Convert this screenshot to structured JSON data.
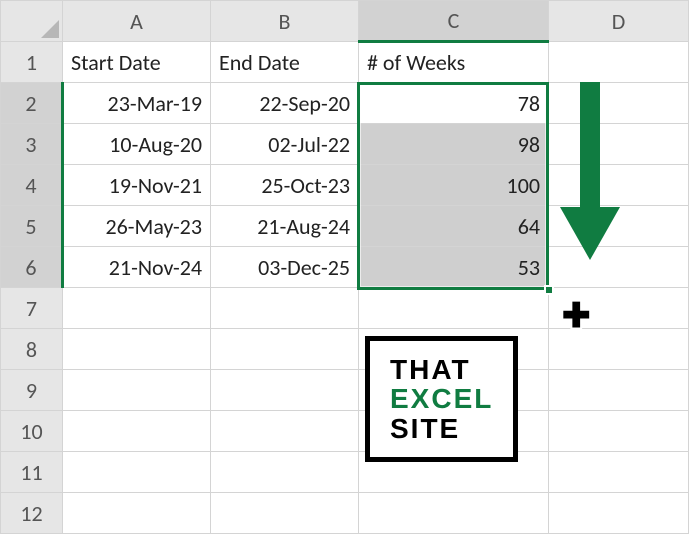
{
  "columns": {
    "A": "A",
    "B": "B",
    "C": "C",
    "D": "D"
  },
  "selectedColumn": "C",
  "rows": [
    "1",
    "2",
    "3",
    "4",
    "5",
    "6",
    "7",
    "8",
    "9",
    "10",
    "11",
    "12"
  ],
  "selectedRows": [
    "2",
    "3",
    "4",
    "5",
    "6"
  ],
  "headers": {
    "A": "Start Date",
    "B": "End Date",
    "C": "# of Weeks"
  },
  "data": [
    {
      "A": "23-Mar-19",
      "B": "22-Sep-20",
      "C": "78"
    },
    {
      "A": "10-Aug-20",
      "B": "02-Jul-22",
      "C": "98"
    },
    {
      "A": "19-Nov-21",
      "B": "25-Oct-23",
      "C": "100"
    },
    {
      "A": "26-May-23",
      "B": "21-Aug-24",
      "C": "64"
    },
    {
      "A": "21-Nov-24",
      "B": "03-Dec-25",
      "C": "53"
    }
  ],
  "logo": {
    "line1": "THAT",
    "line2": "EXCEL",
    "line3": "SITE"
  },
  "colors": {
    "accent": "#107c41"
  },
  "colWidths": {
    "corner": 62,
    "A": 148,
    "B": 148,
    "C": 190,
    "D": 140
  }
}
